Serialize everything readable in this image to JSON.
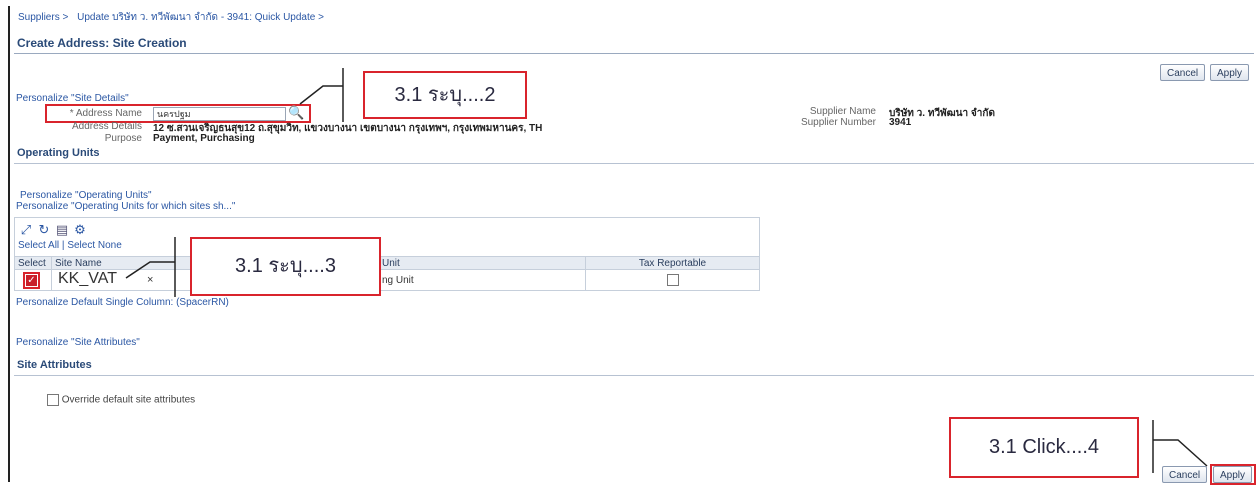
{
  "breadcrumb": {
    "items": [
      "Suppliers >",
      "Update บริษัท ว. ทวีพัฒนา จำกัด - 3941: Quick Update >"
    ]
  },
  "page": {
    "title": "Create Address: Site Creation"
  },
  "buttons": {
    "cancel": "Cancel",
    "apply": "Apply"
  },
  "site_details": {
    "personalize_link": "Personalize \"Site Details\"",
    "address_name_label": "* Address Name",
    "address_name_value": "นครปฐม",
    "address_details_label": "Address Details",
    "address_details_value": "12 ซ.สวนเจริญธนสุข12 ถ.สุขุมวิท, แขวงบางนา เขตบางนา กรุงเทพฯ, กรุงเทพมหานคร, TH",
    "purpose_label": "Purpose",
    "purpose_value": "Payment, Purchasing",
    "supplier_name_label": "Supplier Name",
    "supplier_name_value": "บริษัท ว. ทวีพัฒนา จำกัด",
    "supplier_number_label": "Supplier Number",
    "supplier_number_value": "3941"
  },
  "operating_units": {
    "section_title": "Operating Units",
    "personalize_link": "Personalize \"Operating Units\"",
    "personalize_sites_link": "Personalize \"Operating Units for which sites sh...\"",
    "select_all": "Select All",
    "separator": "|",
    "select_none": "Select None",
    "columns": [
      "Select",
      "Site Name",
      "Unit",
      "Tax Reportable"
    ],
    "row": {
      "site_name": "KK_VAT",
      "clear": "×",
      "unit": "ng Unit"
    },
    "personalize_default": "Personalize Default Single Column: (SpacerRN)"
  },
  "site_attributes": {
    "personalize_link": "Personalize \"Site Attributes\"",
    "section_title": "Site Attributes",
    "override_label": "Override default site attributes"
  },
  "callouts": {
    "step2": "3.1 ระบุ....2",
    "step3": "3.1 ระบุ....3",
    "step4": "3.1 Click....4"
  },
  "colors": {
    "annotation_red": "#d9242c",
    "link_blue": "#2b57a4",
    "header_blue": "#2a4a78"
  },
  "icons": [
    "search-icon",
    "expand-icon",
    "refresh-icon",
    "export-icon",
    "settings-icon",
    "checkbox-checked-icon"
  ]
}
